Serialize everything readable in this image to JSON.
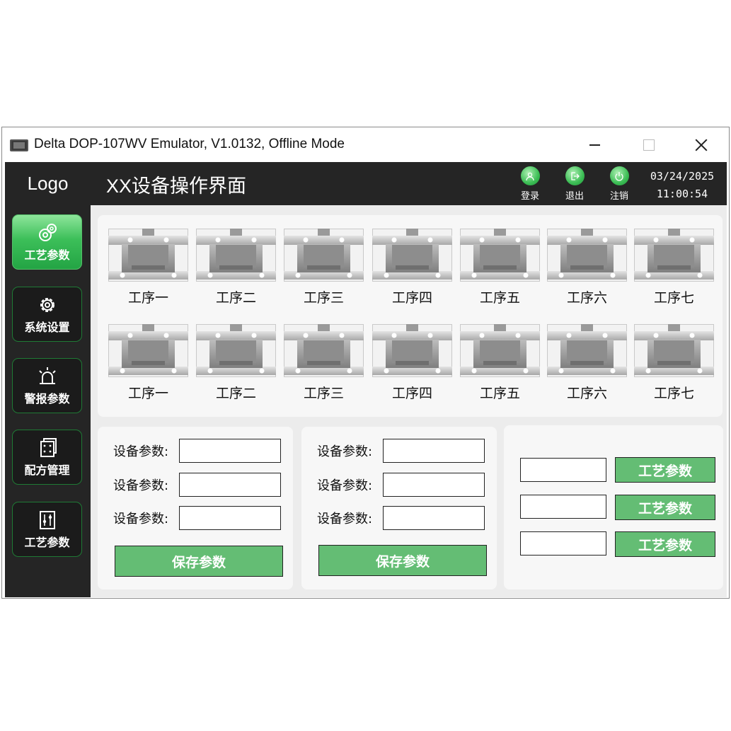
{
  "window": {
    "title": "Delta DOP-107WV Emulator, V1.0132, Offline Mode"
  },
  "sidebar": {
    "logo": "Logo",
    "items": [
      {
        "label": "工艺参数",
        "icon": "gears-icon",
        "active": true
      },
      {
        "label": "系统设置",
        "icon": "gear-icon",
        "active": false
      },
      {
        "label": "警报参数",
        "icon": "alarm-light-icon",
        "active": false
      },
      {
        "label": "配方管理",
        "icon": "recipe-icon",
        "active": false
      },
      {
        "label": "工艺参数",
        "icon": "sliders-icon",
        "active": false
      }
    ]
  },
  "header": {
    "title": "XX设备操作界面",
    "login_label": "登录",
    "exit_label": "退出",
    "logout_label": "注销",
    "date": "03/24/2025",
    "time": "11:00:54",
    "accent_color": "#3bbd54"
  },
  "stations": {
    "row1": [
      "工序一",
      "工序二",
      "工序三",
      "工序四",
      "工序五",
      "工序六",
      "工序七"
    ],
    "row2": [
      "工序一",
      "工序二",
      "工序三",
      "工序四",
      "工序五",
      "工序六",
      "工序七"
    ]
  },
  "param_panels": [
    {
      "fields": [
        {
          "label": "设备参数:",
          "value": ""
        },
        {
          "label": "设备参数:",
          "value": ""
        },
        {
          "label": "设备参数:",
          "value": ""
        }
      ],
      "save_label": "保存参数"
    },
    {
      "fields": [
        {
          "label": "设备参数:",
          "value": ""
        },
        {
          "label": "设备参数:",
          "value": ""
        },
        {
          "label": "设备参数:",
          "value": ""
        }
      ],
      "save_label": "保存参数"
    }
  ],
  "side_panel": {
    "buttons": [
      "工艺参数",
      "工艺参数",
      "工艺参数"
    ]
  },
  "colors": {
    "button_green": "#64bd74",
    "dark_bg": "#252525"
  }
}
